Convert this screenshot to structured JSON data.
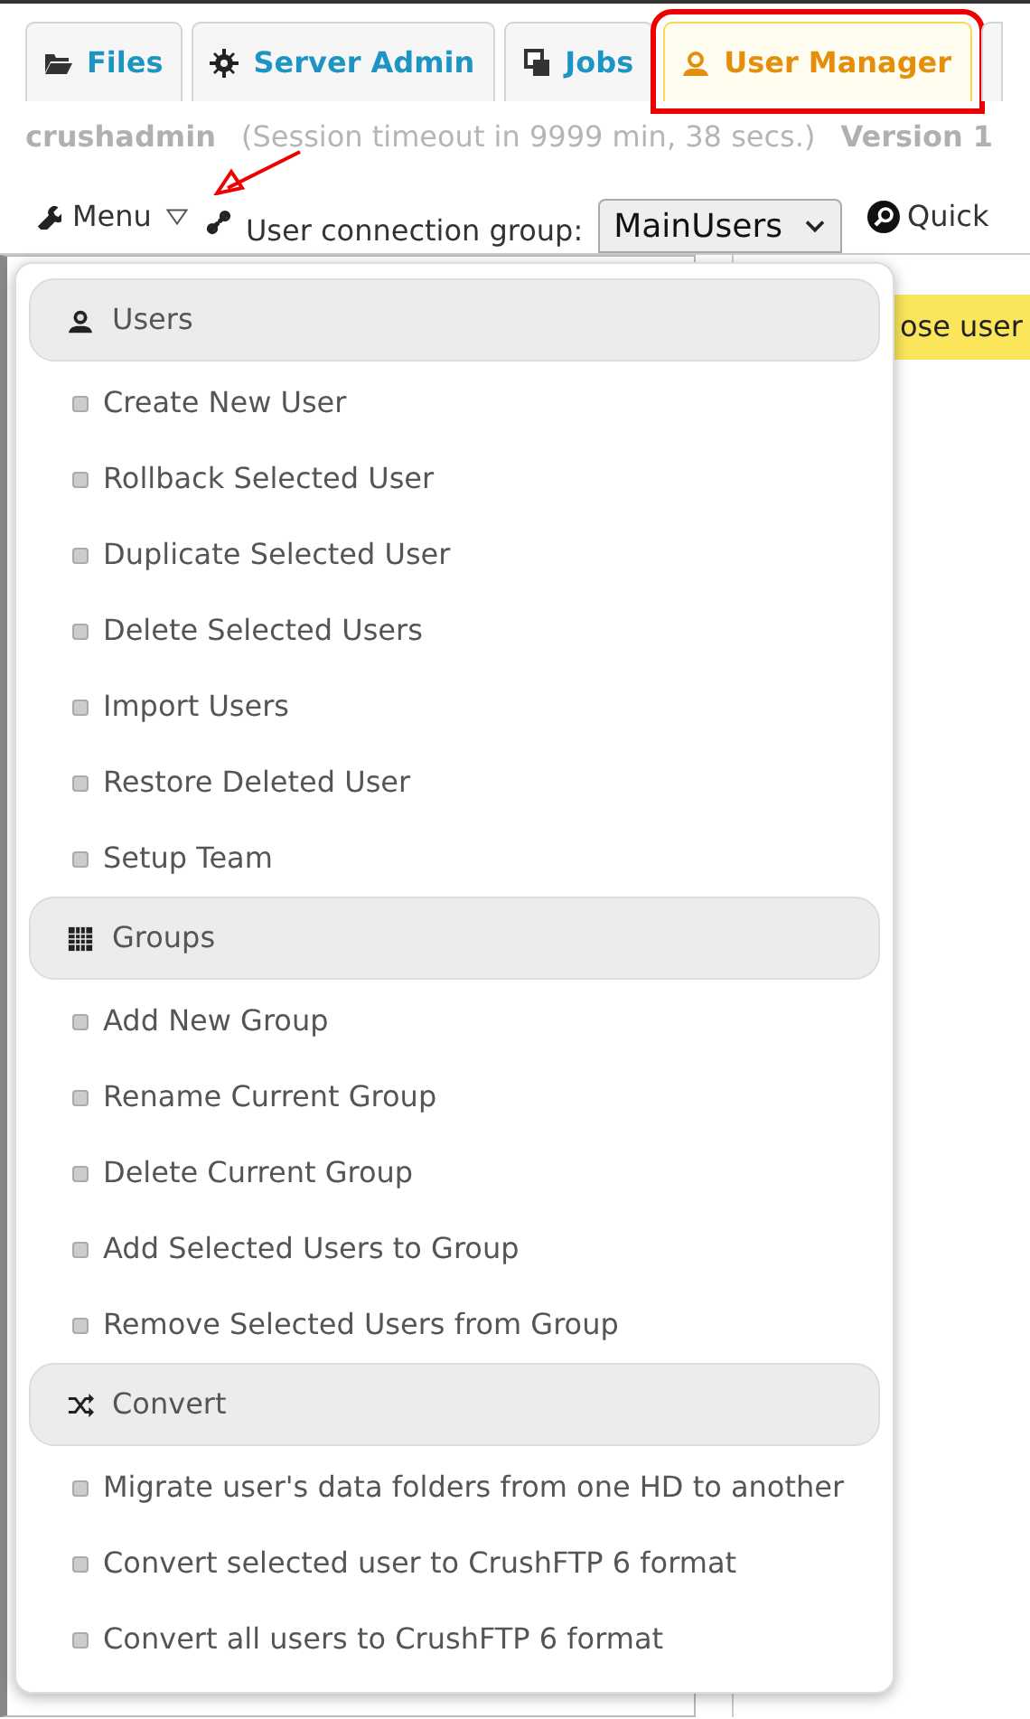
{
  "tabs": [
    {
      "label": "Files",
      "selected": false,
      "highlighted": false
    },
    {
      "label": "Server Admin",
      "selected": false,
      "highlighted": false
    },
    {
      "label": "Jobs",
      "selected": false,
      "highlighted": false
    },
    {
      "label": "User Manager",
      "selected": true,
      "highlighted": true
    }
  ],
  "session": {
    "user": "crushadmin",
    "timeout": "(Session timeout in 9999 min, 38 secs.)",
    "version": "Version 1"
  },
  "toolbar": {
    "menu_label": "Menu",
    "menu_pointed_at": true,
    "group_label": "User connection group:",
    "group_value": "MainUsers",
    "quick_label": "Quick"
  },
  "notice": "ose user",
  "menu": {
    "open": true,
    "sections": [
      {
        "title": "Users",
        "items": [
          "Create New User",
          "Rollback Selected User",
          "Duplicate Selected User",
          "Delete Selected Users",
          "Import Users",
          "Restore Deleted User",
          "Setup Team"
        ]
      },
      {
        "title": "Groups",
        "items": [
          "Add New Group",
          "Rename Current Group",
          "Delete Current Group",
          "Add Selected Users to Group",
          "Remove Selected Users from Group"
        ]
      },
      {
        "title": "Convert",
        "items": [
          "Migrate user's data folders from one HD to another",
          "Convert selected user to CrushFTP 6 format",
          "Convert all users to CrushFTP 6 format"
        ]
      }
    ]
  }
}
